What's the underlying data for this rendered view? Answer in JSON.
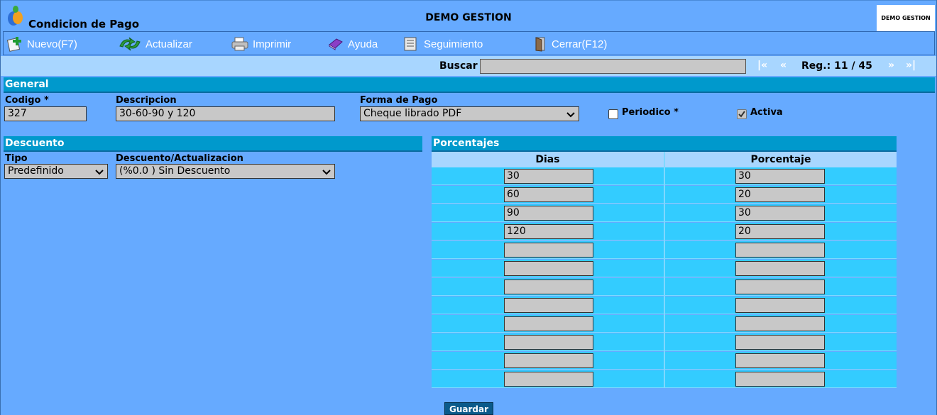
{
  "header": {
    "title": "Condicion de Pago",
    "center_title": "DEMO GESTION",
    "brand_label": "DEMO GESTION"
  },
  "toolbar": {
    "nuevo": "Nuevo(F7)",
    "actualizar": "Actualizar",
    "imprimir": "Imprimir",
    "ayuda": "Ayuda",
    "seguimiento": "Seguimiento",
    "cerrar": "Cerrar(F12)"
  },
  "search": {
    "label": "Buscar",
    "value": "",
    "first": "|«",
    "prev": "«",
    "record": "Reg.: 11 / 45",
    "next": "»",
    "last": "»|"
  },
  "general": {
    "section_title": "General",
    "codigo_label": "Codigo *",
    "codigo_value": "327",
    "descripcion_label": "Descripcion",
    "descripcion_value": "30-60-90 y 120",
    "forma_label": "Forma de Pago",
    "forma_value": "Cheque librado PDF",
    "periodico_label": "Periodico *",
    "periodico_checked": false,
    "activa_label": "Activa",
    "activa_checked": true
  },
  "descuento": {
    "section_title": "Descuento",
    "tipo_label": "Tipo",
    "tipo_value": "Predefinido",
    "desc_label": "Descuento/Actualizacion",
    "desc_value": "(%0.0 ) Sin Descuento"
  },
  "porcentajes": {
    "section_title": "Porcentajes",
    "col_dias": "Dias",
    "col_porcentaje": "Porcentaje",
    "rows": [
      {
        "dias": "30",
        "porcentaje": "30"
      },
      {
        "dias": "60",
        "porcentaje": "20"
      },
      {
        "dias": "90",
        "porcentaje": "30"
      },
      {
        "dias": "120",
        "porcentaje": "20"
      },
      {
        "dias": "",
        "porcentaje": ""
      },
      {
        "dias": "",
        "porcentaje": ""
      },
      {
        "dias": "",
        "porcentaje": ""
      },
      {
        "dias": "",
        "porcentaje": ""
      },
      {
        "dias": "",
        "porcentaje": ""
      },
      {
        "dias": "",
        "porcentaje": ""
      },
      {
        "dias": "",
        "porcentaje": ""
      },
      {
        "dias": "",
        "porcentaje": ""
      }
    ]
  },
  "actions": {
    "guardar": "Guardar"
  }
}
